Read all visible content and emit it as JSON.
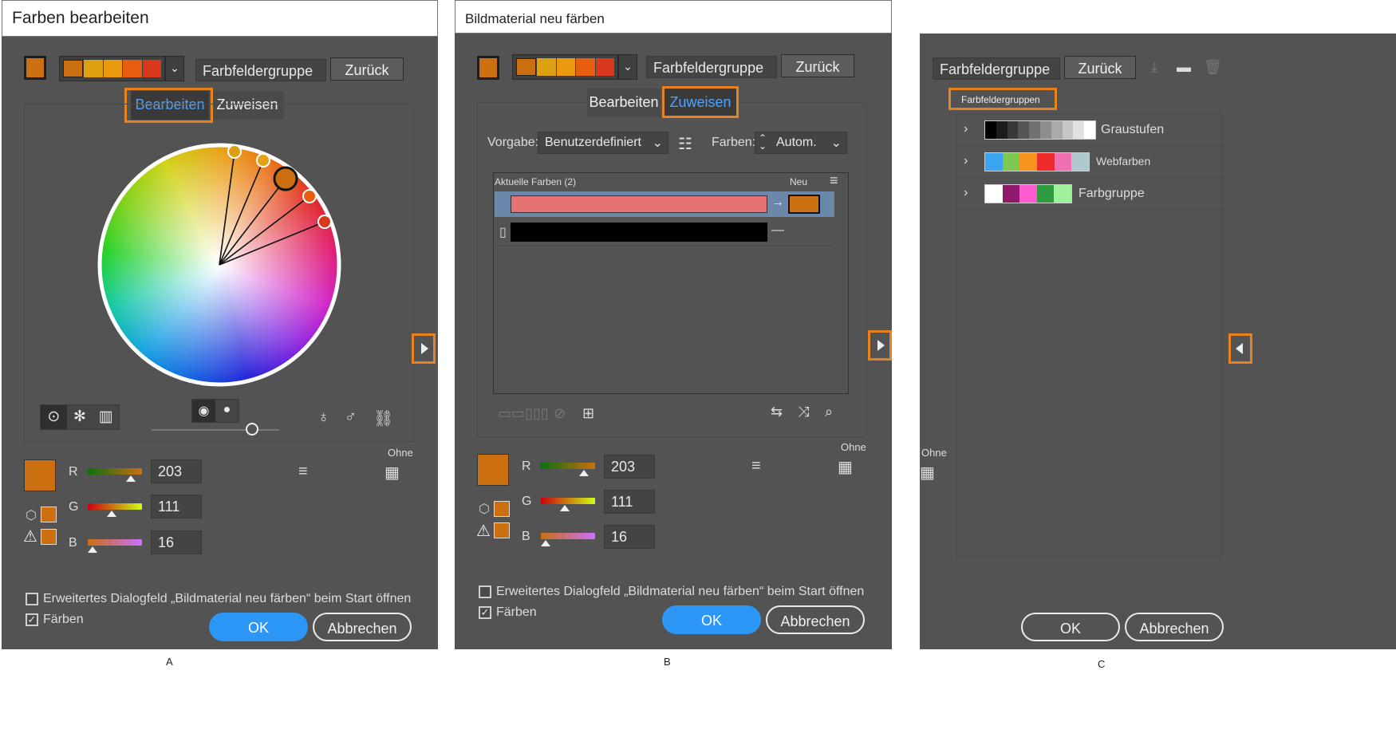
{
  "panel_a": {
    "title": "Farben bearbeiten",
    "group_field": "Farbfeldergruppe",
    "back_button": "Zurück",
    "tabs": [
      "Bearbeiten",
      "Zuweisen"
    ],
    "active_tab": "Bearbeiten",
    "rgb": {
      "r_label": "R",
      "g_label": "G",
      "b_label": "B",
      "r": "203",
      "g": "111",
      "b": "16"
    },
    "none_label": "Ohne",
    "checkbox_extended": "Erweitertes Dialogfeld „Bildmaterial neu färben“ beim Start öffnen",
    "checkbox_color": "Färben",
    "checkbox_extended_checked": false,
    "checkbox_color_checked": true,
    "ok": "OK",
    "cancel": "Abbrechen",
    "caption": "A"
  },
  "panel_b": {
    "title": "Bildmaterial neu färben",
    "group_field": "Farbfeldergruppe",
    "back_button": "Zurück",
    "tabs": [
      "Bearbeiten",
      "Zuweisen"
    ],
    "active_tab": "Zuweisen",
    "preset_label": "Vorgabe:",
    "preset_value": "Benutzerdefiniert",
    "colors_label": "Farben:",
    "colors_value": "Autom.",
    "current_colors_label": "Aktuelle Farben (2)",
    "new_label": "Neu",
    "rgb": {
      "r_label": "R",
      "g_label": "G",
      "b_label": "B",
      "r": "203",
      "g": "111",
      "b": "16"
    },
    "none_label": "Ohne",
    "checkbox_extended": "Erweitertes Dialogfeld „Bildmaterial neu färben“ beim Start öffnen",
    "checkbox_color": "Färben",
    "ok": "OK",
    "cancel": "Abbrechen",
    "caption": "B"
  },
  "panel_c": {
    "group_field": "Farbfeldergruppe",
    "back_button": "Zurück",
    "section_label": "Farbfeldergruppen",
    "groups": [
      {
        "name": "Graustufen",
        "colors": [
          "#000000",
          "#1c1c1c",
          "#383838",
          "#555555",
          "#717171",
          "#8e8e8e",
          "#aaaaaa",
          "#c6c6c6",
          "#e2e2e2",
          "#ffffff"
        ]
      },
      {
        "name": "Webfarben",
        "colors": [
          "#3ba3f0",
          "#7cc850",
          "#f7941d",
          "#ee2b2b",
          "#ef6fb0",
          "#b0c8d0"
        ]
      },
      {
        "name": "Farbgruppe",
        "colors": [
          "#ffffff",
          "#8e1a6e",
          "#ff5ad0",
          "#2f9a40",
          "#9ef29a"
        ]
      }
    ],
    "none_label": "Ohne",
    "ok": "OK",
    "cancel": "Abbrechen",
    "caption": "C"
  },
  "harmony_colors": [
    "#cb6f10",
    "#dca010",
    "#eb9a10",
    "#e85e10",
    "#d8381c"
  ],
  "accent_colors": {
    "highlight": "#e8821e",
    "ok_blue": "#2d97f7",
    "active_tab_blue": "#4ea3ff",
    "current_color": "#e57373",
    "selected_swatch": "#cb6f10"
  }
}
